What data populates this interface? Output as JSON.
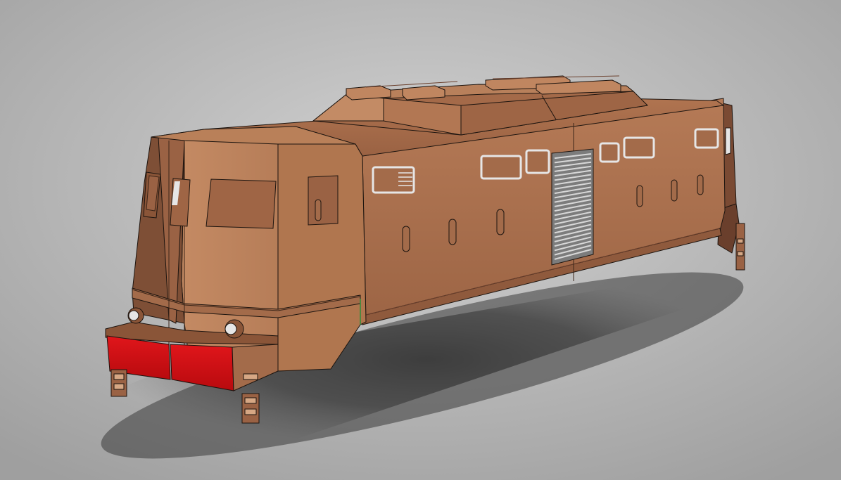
{
  "scene": {
    "subject": "locomotive-body-3d-model",
    "colors": {
      "background_light": "#c9c9c9",
      "background_dark": "#a8a8a8",
      "body_light": "#c08660",
      "body_mid": "#a06848",
      "body_dark": "#6e4430",
      "buffer_beam": "#d40d12",
      "glass": "#e6e6e6",
      "grille": "#b8b8b8",
      "shadow": "#3a3a3a",
      "edge": "#1c140f"
    }
  }
}
